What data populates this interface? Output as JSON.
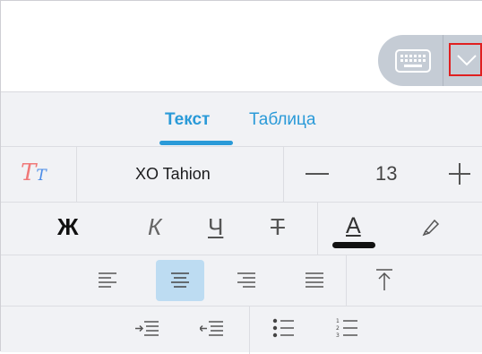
{
  "tabs": [
    {
      "label": "Текст",
      "selected": true
    },
    {
      "label": "Таблица",
      "selected": false
    }
  ],
  "font": {
    "style_label_big": "T",
    "style_label_small": "T",
    "name": "XO Tahion",
    "size": "13"
  },
  "format": {
    "bold": "Ж",
    "italic": "К",
    "underline": "Ч",
    "strikethrough": "Т",
    "text_color": "А"
  },
  "colors": {
    "accent": "#2a9ad8",
    "panel_bg": "#f1f2f5",
    "selected_bg": "#bddcf2",
    "keyboard_pill": "#c5ccd5",
    "highlight_box": "#e02020"
  },
  "icons": [
    "keyboard-icon",
    "chevron-down-icon",
    "text-style-icon",
    "marker-icon",
    "align-left-icon",
    "align-center-icon",
    "align-right-icon",
    "align-justify-icon",
    "align-top-icon",
    "indent-increase-icon",
    "indent-decrease-icon",
    "bullet-list-icon",
    "numbered-list-icon"
  ]
}
